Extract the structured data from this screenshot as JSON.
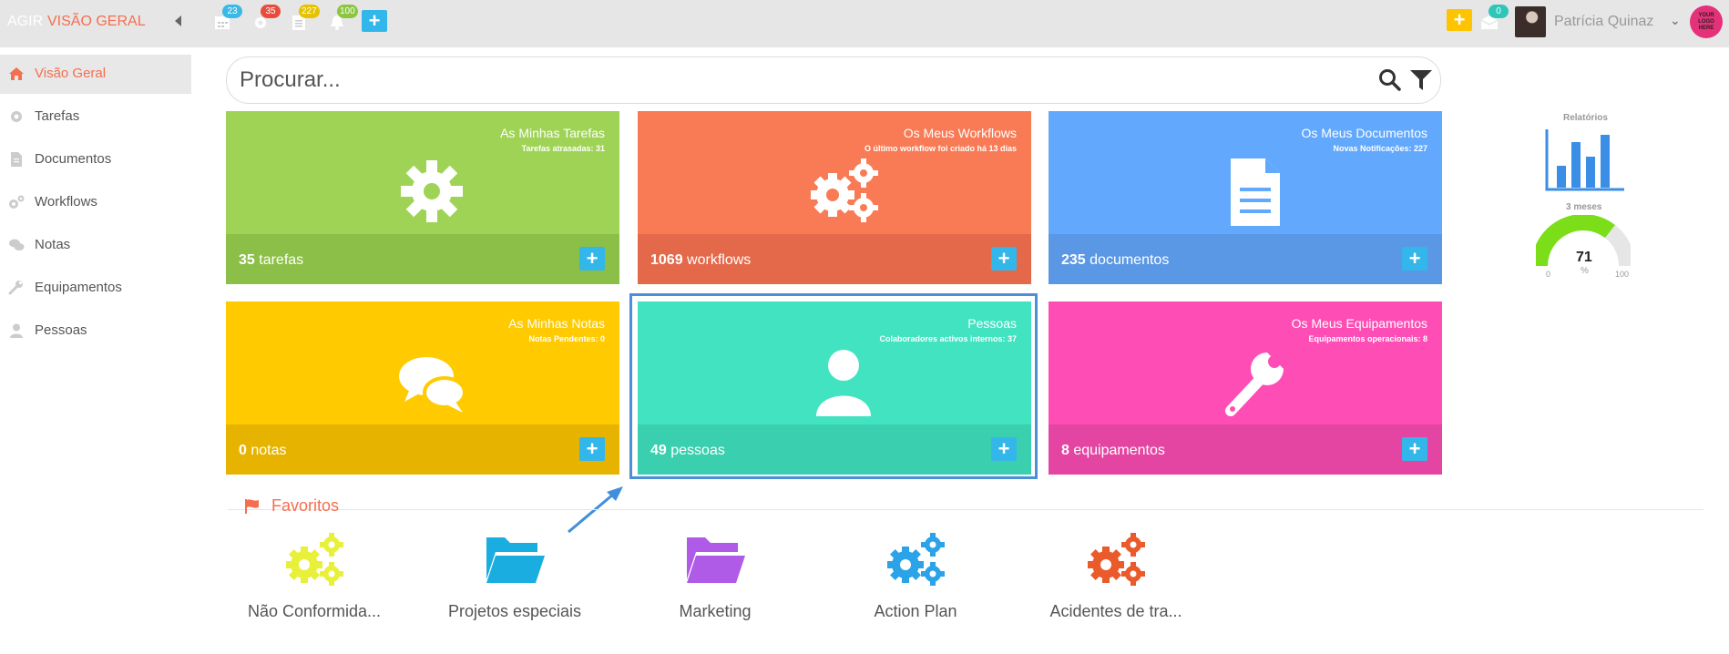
{
  "topbar": {
    "brand": "AGIR",
    "crumb": "VISÃO GERAL",
    "badges": {
      "calendar": "23",
      "settings": "35",
      "documents": "227",
      "notifications": "100",
      "messages": "0"
    },
    "user_name": "Patrícia Quinaz",
    "logo_text": "YOUR LOGO HERE"
  },
  "sidebar": {
    "items": [
      {
        "label": "Visão Geral",
        "icon": "home-icon"
      },
      {
        "label": "Tarefas",
        "icon": "gear-icon"
      },
      {
        "label": "Documentos",
        "icon": "document-icon"
      },
      {
        "label": "Workflows",
        "icon": "gears-icon"
      },
      {
        "label": "Notas",
        "icon": "comments-icon"
      },
      {
        "label": "Equipamentos",
        "icon": "wrench-icon"
      },
      {
        "label": "Pessoas",
        "icon": "user-icon"
      }
    ]
  },
  "search": {
    "placeholder": "Procurar..."
  },
  "tiles": [
    {
      "title": "As Minhas Tarefas",
      "subtitle": "Tarefas atrasadas: 31",
      "count": "35",
      "unit": "tarefas",
      "color": "#9fd356",
      "foot": "#8cbf47"
    },
    {
      "title": "Os Meus Workflows",
      "subtitle": "O último workflow foi criado há 13 dias",
      "count": "1069",
      "unit": "workflows",
      "color": "#f87b56",
      "foot": "#e4694a"
    },
    {
      "title": "Os Meus Documentos",
      "subtitle": "Novas Notificações: 227",
      "count": "235",
      "unit": "documentos",
      "color": "#62a8fd",
      "foot": "#5a98e6"
    },
    {
      "title": "As Minhas Notas",
      "subtitle": "Notas Pendentes: 0",
      "count": "0",
      "unit": "notas",
      "color": "#ffca00",
      "foot": "#e6b400"
    },
    {
      "title": "Pessoas",
      "subtitle": "Colaboradores activos internos: 37",
      "count": "49",
      "unit": "pessoas",
      "color": "#41e3c0",
      "foot": "#3acfae"
    },
    {
      "title": "Os Meus Equipamentos",
      "subtitle": "Equipamentos operacionais: 8",
      "count": "8",
      "unit": "equipamentos",
      "color": "#fe4eb5",
      "foot": "#e545a2"
    }
  ],
  "widgets": {
    "reports_label": "Relatórios",
    "period_label": "3 meses",
    "gauge": {
      "value": "71",
      "unit": "%",
      "min": "0",
      "max": "100",
      "fraction": 0.71
    }
  },
  "favorites": {
    "title": "Favoritos",
    "items": [
      {
        "label": "Não Conformida...",
        "icon": "gears-icon",
        "color": "#e8f03a"
      },
      {
        "label": "Projetos especiais",
        "icon": "folder-icon",
        "color": "#1aaee0"
      },
      {
        "label": "Marketing",
        "icon": "folder-icon",
        "color": "#b05be8"
      },
      {
        "label": "Action Plan",
        "icon": "gears-icon",
        "color": "#2ba3e8"
      },
      {
        "label": "Acidentes de tra...",
        "icon": "gears-icon",
        "color": "#ea5a2b"
      }
    ]
  }
}
